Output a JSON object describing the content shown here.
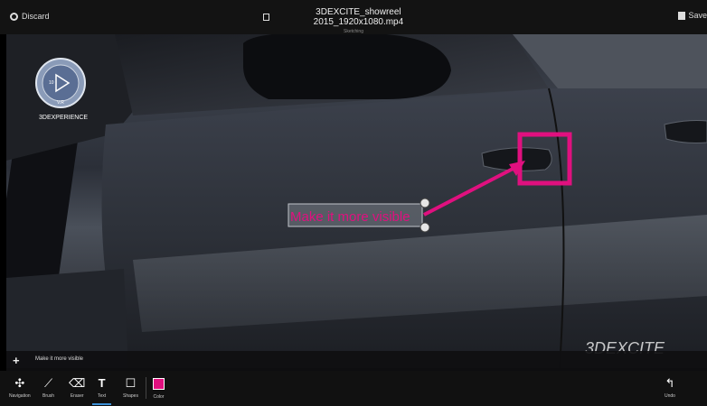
{
  "topbar": {
    "discard_label": "Discard",
    "file_name": "3DEXCITE_showreel 2015_1920x1080.mp4",
    "subtitle": "Sketching",
    "save_label": "Save"
  },
  "compass": {
    "num_left": "10",
    "version_label": "V.R",
    "brand": "3DEXPERIENCE"
  },
  "annotation": {
    "text": "Make it more visible",
    "color": "#e0107f"
  },
  "comment_bar": {
    "add_symbol": "+",
    "text": "Make it more visible"
  },
  "toolbar": {
    "tools": [
      {
        "label": "Navigation",
        "icon": "navigation-icon",
        "glyph": "✣"
      },
      {
        "label": "Brush",
        "icon": "brush-icon",
        "glyph": "⟋"
      },
      {
        "label": "Eraser",
        "icon": "eraser-icon",
        "glyph": "⌫"
      },
      {
        "label": "Text",
        "icon": "text-icon",
        "glyph": "T",
        "active": true
      },
      {
        "label": "Shapes",
        "icon": "shapes-icon",
        "glyph": "☐"
      }
    ],
    "color_label": "Color",
    "color_value": "#e0107f",
    "undo_label": "Undo",
    "undo_glyph": "↰"
  },
  "watermark": {
    "text": "3DEXCITE"
  }
}
